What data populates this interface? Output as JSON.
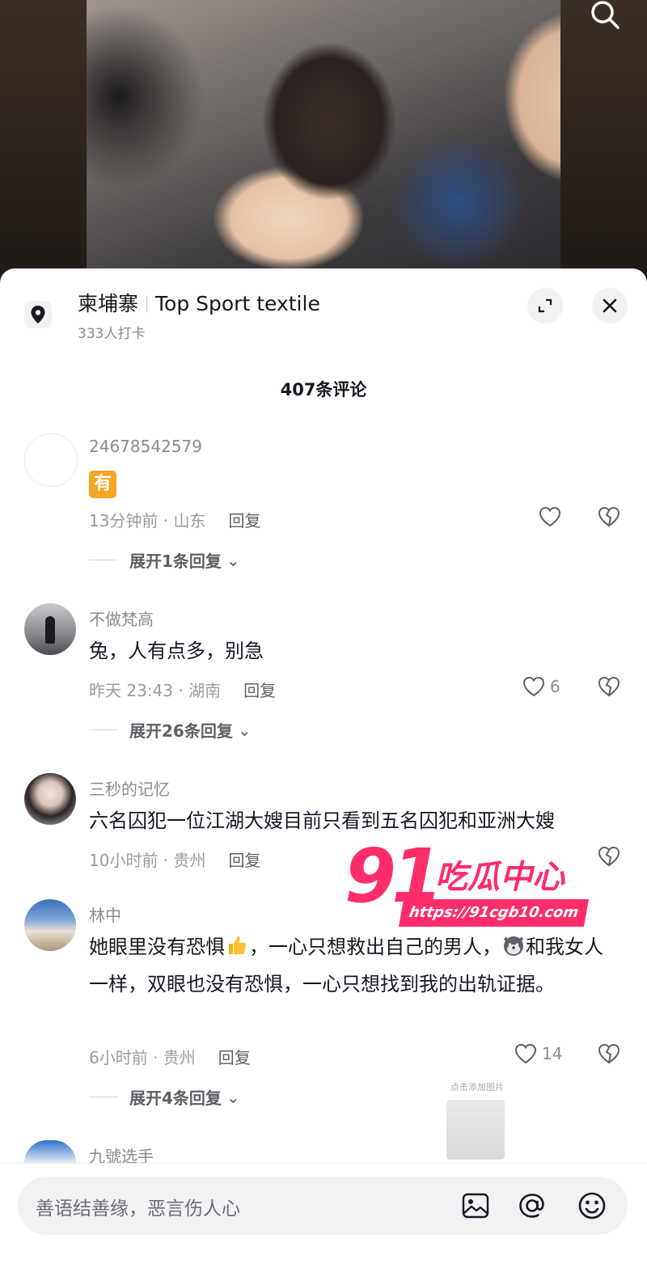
{
  "location": {
    "name": "柬埔寨",
    "place": "Top Sport textile",
    "checkins": "333人打卡"
  },
  "comment_count": "407条评论",
  "comments": [
    {
      "username": "24678542579",
      "text": "有",
      "time_region": "13分钟前 · 山东",
      "reply_label": "回复",
      "likes": "",
      "expand": "展开1条回复"
    },
    {
      "username": "不做梵高",
      "text": "兔，人有点多，别急",
      "time_region": "昨天 23:43 · 湖南",
      "reply_label": "回复",
      "likes": "6",
      "expand": "展开26条回复"
    },
    {
      "username": "三秒的记忆",
      "text": "六名囚犯一位江湖大嫂目前只看到五名囚犯和亚洲大嫂",
      "time_region": "10小时前 · 贵州",
      "reply_label": "回复",
      "likes": "",
      "expand": ""
    },
    {
      "username": "林中",
      "text_part1": "她眼里没有恐惧",
      "text_part2": "，一心只想救出自己的男人，",
      "text_part3": "和我女人一样，双眼也没有恐惧，一心只想找到我的出轨证据。",
      "time_region": "6小时前 · 贵州",
      "reply_label": "回复",
      "likes": "14",
      "expand": "展开4条回复"
    },
    {
      "username": "九號选手"
    }
  ],
  "watermark": {
    "number": "91",
    "name": "吃瓜中心",
    "url": "https://91cgb10.com"
  },
  "image_hint": "点击添加图片",
  "input": {
    "placeholder": "善语结善缘，恶言伤人心"
  },
  "colors": {
    "watermark": "#ff2d6a",
    "tag": "#f6a623"
  }
}
